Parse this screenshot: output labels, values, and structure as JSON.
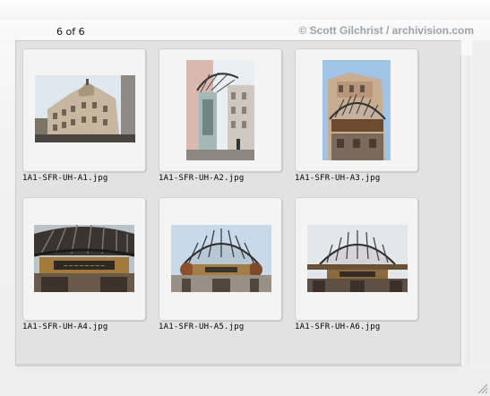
{
  "header": {
    "counter": "6 of 6",
    "copyright": "© Scott Gilchrist / archivision.com"
  },
  "thumbnails": [
    {
      "filename": "1A1-SFR-UH-A1.jpg",
      "icon": "building-corner-photo"
    },
    {
      "filename": "1A1-SFR-UH-A2.jpg",
      "icon": "canopy-street-photo"
    },
    {
      "filename": "1A1-SFR-UH-A3.jpg",
      "icon": "canopy-facade-photo"
    },
    {
      "filename": "1A1-SFR-UH-A4.jpg",
      "icon": "canopy-sign-photo"
    },
    {
      "filename": "1A1-SFR-UH-A5.jpg",
      "icon": "canopy-underside-photo"
    },
    {
      "filename": "1A1-SFR-UH-A6.jpg",
      "icon": "canopy-front-photo"
    }
  ]
}
